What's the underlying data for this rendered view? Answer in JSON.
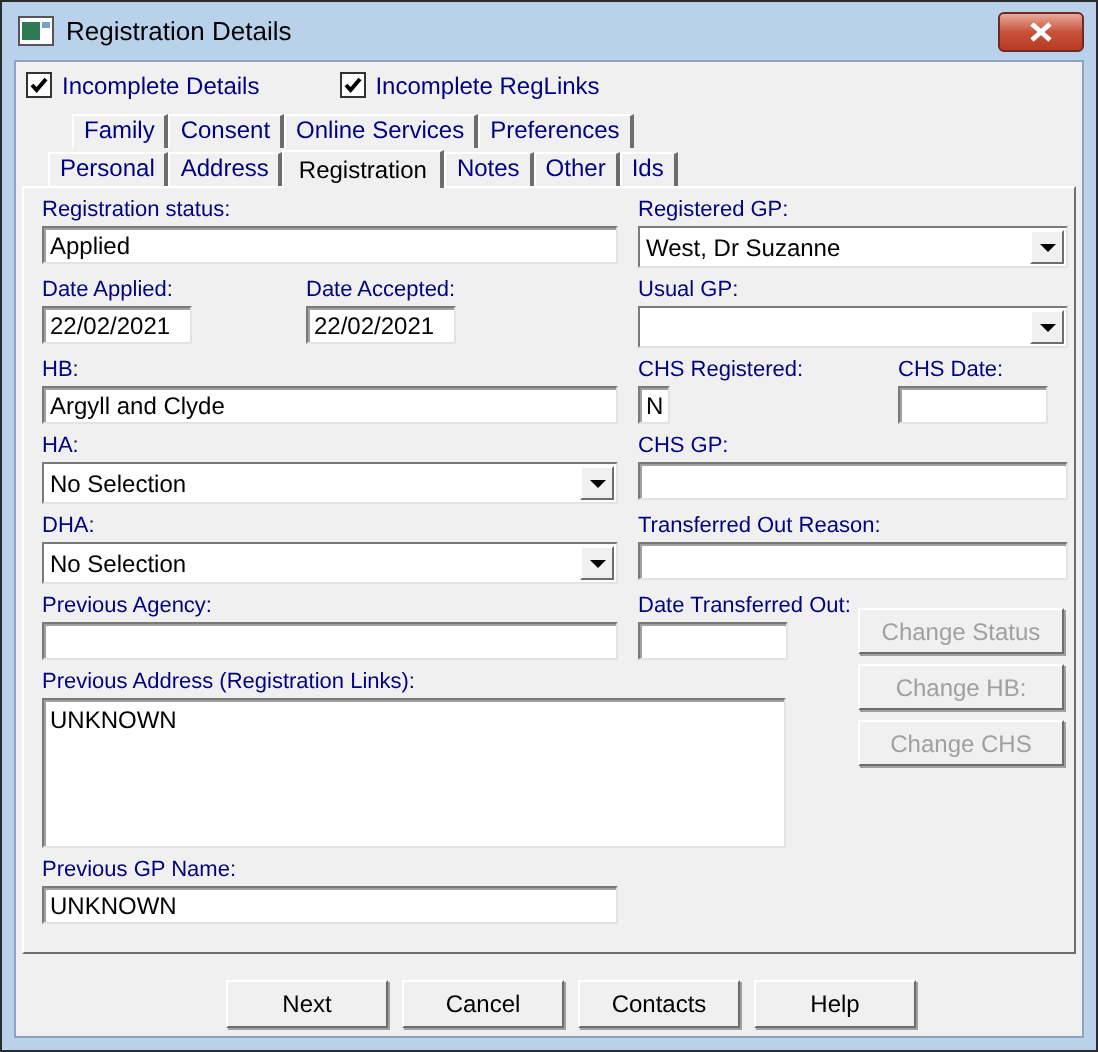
{
  "window": {
    "title": "Registration Details"
  },
  "checkboxes": [
    {
      "label": "Incomplete Details",
      "checked": true
    },
    {
      "label": "Incomplete RegLinks",
      "checked": true
    }
  ],
  "tab_rows": [
    {
      "tabs": [
        {
          "label": "Family",
          "selected": false
        },
        {
          "label": "Consent",
          "selected": false
        },
        {
          "label": "Online Services",
          "selected": false
        },
        {
          "label": "Preferences",
          "selected": false
        }
      ]
    },
    {
      "tabs": [
        {
          "label": "Personal",
          "selected": false
        },
        {
          "label": "Address",
          "selected": false
        },
        {
          "label": "Registration",
          "selected": true
        },
        {
          "label": "Notes",
          "selected": false
        },
        {
          "label": "Other",
          "selected": false
        },
        {
          "label": "Ids",
          "selected": false
        }
      ]
    }
  ],
  "fields": [
    {
      "label": "Registration status:",
      "kind": "text",
      "value": "Applied"
    },
    {
      "label": "Registered GP:",
      "kind": "select",
      "value": "West, Dr Suzanne"
    },
    {
      "label": "Date Applied:",
      "kind": "text",
      "value": "22/02/2021"
    },
    {
      "label": "Date Accepted:",
      "kind": "text",
      "value": "22/02/2021"
    },
    {
      "label": "Usual GP:",
      "kind": "select"
    },
    {
      "label": "HB:",
      "kind": "text",
      "value": "Argyll and Clyde"
    },
    {
      "label": "CHS Registered:",
      "kind": "text",
      "value": "N"
    },
    {
      "label": "CHS Date:",
      "kind": "text"
    },
    {
      "label": "HA:",
      "kind": "select",
      "value": "No Selection"
    },
    {
      "label": "CHS GP:",
      "kind": "text"
    },
    {
      "label": "DHA:",
      "kind": "select",
      "value": "No Selection"
    },
    {
      "label": "Transferred Out Reason:",
      "kind": "text"
    },
    {
      "label": "Previous Agency:",
      "kind": "text"
    },
    {
      "label": "Date Transferred Out:",
      "kind": "text"
    },
    {
      "label": "Previous Address (Registration Links):",
      "kind": "textarea",
      "value": "UNKNOWN"
    },
    {
      "label": "Previous GP Name:",
      "kind": "text",
      "value": "UNKNOWN"
    }
  ],
  "side_buttons": [
    {
      "label": "Change Status",
      "disabled": true
    },
    {
      "label": "Change HB:",
      "disabled": true
    },
    {
      "label": "Change CHS",
      "disabled": true
    }
  ],
  "buttons": [
    {
      "label": "Next"
    },
    {
      "label": "Cancel"
    },
    {
      "label": "Contacts"
    },
    {
      "label": "Help"
    }
  ]
}
